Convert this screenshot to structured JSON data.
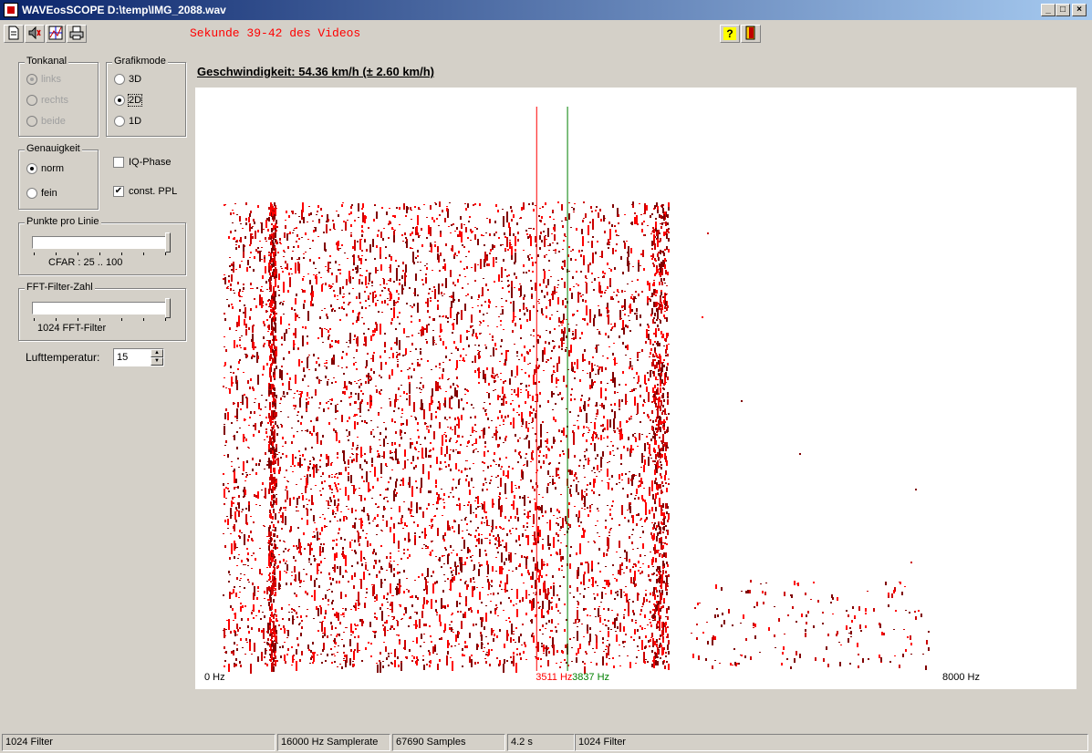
{
  "window": {
    "title": "WAVEosSCOPE  D:\\temp\\IMG_2088.wav",
    "minimize": "_",
    "maximize": "□",
    "close": "×"
  },
  "toolbar": {
    "video_range": "Sekunde 39-42 des Videos",
    "icons": [
      "new-file-icon",
      "speaker-icon",
      "chart-icon",
      "print-icon",
      "help-icon",
      "exit-door-icon"
    ],
    "help_glyph": "?"
  },
  "tonkanal": {
    "legend": "Tonkanal",
    "options": [
      {
        "label": "links",
        "selected": true
      },
      {
        "label": "rechts",
        "selected": false
      },
      {
        "label": "beide",
        "selected": false
      }
    ]
  },
  "grafikmode": {
    "legend": "Grafikmode",
    "options": [
      {
        "label": "3D",
        "selected": false
      },
      {
        "label": "2D",
        "selected": true
      },
      {
        "label": "1D",
        "selected": false
      }
    ]
  },
  "genauigkeit": {
    "legend": "Genauigkeit",
    "options": [
      {
        "label": "norm",
        "selected": true
      },
      {
        "label": "fein",
        "selected": false
      }
    ]
  },
  "checkboxes": {
    "iq_phase": {
      "label": "IQ-Phase",
      "checked": false
    },
    "const_ppl": {
      "label": "const. PPL",
      "checked": true
    }
  },
  "punkte": {
    "legend": "Punkte pro Linie",
    "value_text": "CFAR : 25 .. 100",
    "position": 1.0
  },
  "fft": {
    "legend": "FFT-Filter-Zahl",
    "value_text": "1024 FFT-Filter",
    "position": 1.0
  },
  "temperature": {
    "label": "Lufttemperatur:",
    "value": "15"
  },
  "speed": "Geschwindigkeit: 54.36 km/h (± 2.60 km/h)",
  "plot": {
    "x_min_label": "0 Hz",
    "x_max_label": "8000 Hz",
    "freq_min": 0,
    "freq_max": 8000,
    "marker_red": {
      "label": "3511 Hz",
      "freq": 3511,
      "color": "#ff0000"
    },
    "marker_green": {
      "label": "3837 Hz",
      "freq": 3837,
      "color": "#008000"
    },
    "dot_colors": [
      "#cc0000",
      "#ff0000",
      "#800000"
    ]
  },
  "statusbar": [
    "1024 Filter",
    "16000 Hz Samplerate",
    "67690 Samples",
    "4.2 s",
    "1024 Filter"
  ]
}
